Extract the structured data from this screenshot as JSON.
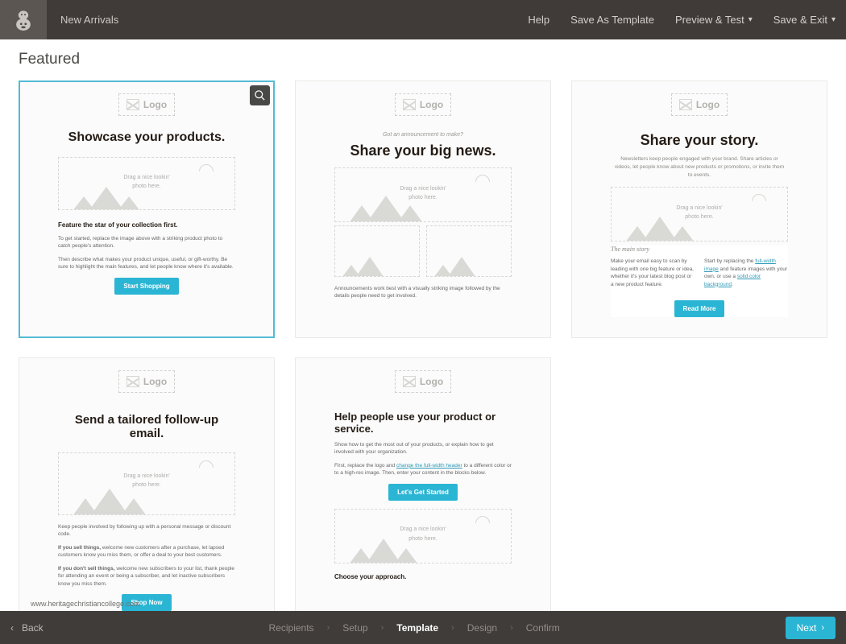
{
  "topbar": {
    "title": "New Arrivals",
    "help": "Help",
    "save_template": "Save As Template",
    "preview": "Preview & Test",
    "save_exit": "Save & Exit"
  },
  "section_title": "Featured",
  "templates": {
    "t1": {
      "logo": "Logo",
      "heading": "Showcase your products.",
      "ph_l1": "Drag a nice lookin'",
      "ph_l2": "photo here.",
      "lead": "Feature the star of your collection first.",
      "p1": "To get started, replace the image above with a striking product photo to catch people's attention.",
      "p2": "Then describe what makes your product unique, useful, or gift-worthy. Be sure to highlight the main features, and let people know where it's available.",
      "cta": "Start Shopping"
    },
    "t2": {
      "logo": "Logo",
      "sup": "Got an announcement to make?",
      "heading": "Share your big news.",
      "ph_l1": "Drag a nice lookin'",
      "ph_l2": "photo here.",
      "foot": "Announcements work best with a visually striking image followed by the details people need to get involved."
    },
    "t3": {
      "logo": "Logo",
      "heading": "Share your story.",
      "desc": "Newsletters keep people engaged with your brand. Share articles or videos, let people know about new products or promotions, or invite them to events.",
      "ph_l1": "Drag a nice lookin'",
      "ph_l2": "photo here.",
      "story": "The main story",
      "p1_a": "Make your email easy to scan by leading with one big feature or idea, whether it's your latest blog post or a new product feature.",
      "p2_a": "Start by replacing the ",
      "p2_link1": "full-width image",
      "p2_b": " and feature images with your own, or use a ",
      "p2_link2": "solid color background",
      "p2_c": ".",
      "cta": "Read More"
    },
    "t4": {
      "logo": "Logo",
      "heading": "Send a tailored follow-up email.",
      "ph_l1": "Drag a nice lookin'",
      "ph_l2": "photo here.",
      "p1": "Keep people involved by following up with a personal message or discount code.",
      "p2_a": "If you sell things,",
      "p2_b": " welcome new customers after a purchase, let lapsed customers know you miss them, or offer a deal to your best customers.",
      "p3_a": "If you don't sell things,",
      "p3_b": " welcome new subscribers to your list, thank people for attending an event or being a subscriber, and let inactive subscribers know you miss them.",
      "cta": "Shop Now"
    },
    "t5": {
      "logo": "Logo",
      "heading": "Help people use your product or service.",
      "p1": "Show how to get the most out of your products, or explain how to get involved with your organization.",
      "p2_a": "First, replace the logo and ",
      "p2_link": "change the full-width header",
      "p2_b": " to a different color or to a high-res image. Then, enter your content in the blocks below.",
      "cta": "Let's Get Started",
      "ph_l1": "Drag a nice lookin'",
      "ph_l2": "photo here.",
      "approach": "Choose your approach."
    }
  },
  "watermark": "www.heritagechristiancollege.com",
  "footer": {
    "back": "Back",
    "steps": [
      "Recipients",
      "Setup",
      "Template",
      "Design",
      "Confirm"
    ],
    "active_index": 2,
    "next": "Next"
  }
}
